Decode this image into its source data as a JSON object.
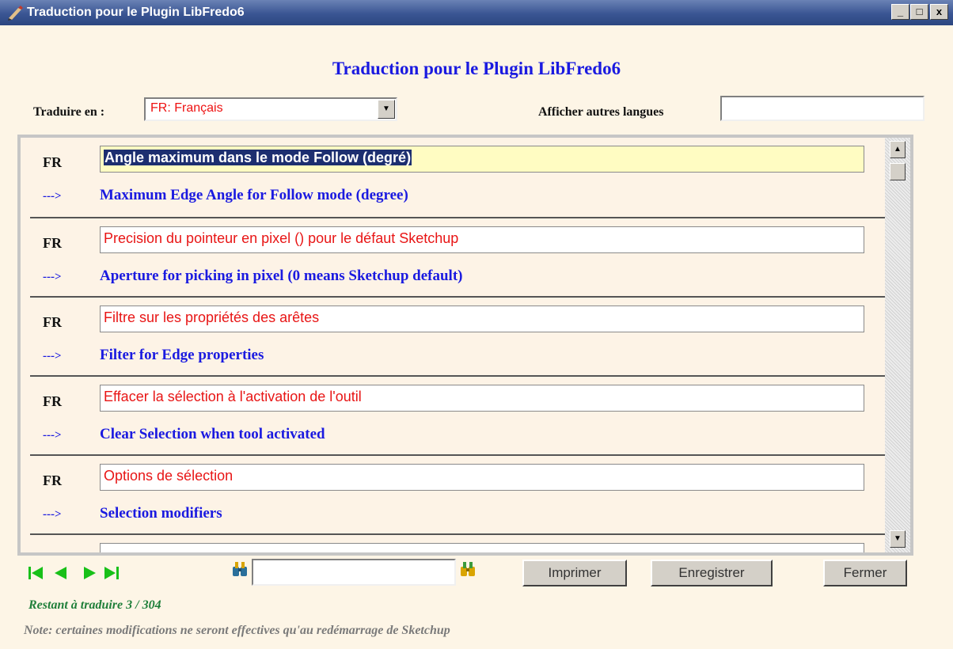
{
  "window": {
    "title": "Traduction pour le Plugin LibFredo6",
    "minimize": "_",
    "maximize": "□",
    "close": "x"
  },
  "heading": "Traduction pour le Plugin LibFredo6",
  "traduire_label": "Traduire en :",
  "language_select": {
    "value": "FR: Français"
  },
  "afficher_label": "Afficher autres langues",
  "afficher_value": "",
  "arrow_prefix": "--->",
  "entries": [
    {
      "code": "FR",
      "translation_text": "Angle maximum dans le mode Follow (degré)",
      "original": "Maximum Edge Angle for Follow mode (degree)"
    },
    {
      "code": "FR",
      "translation": "Precision du pointeur en pixel () pour le défaut Sketchup",
      "original": "Aperture for picking in pixel (0 means Sketchup default)"
    },
    {
      "code": "FR",
      "translation": "Filtre sur les propriétés des arêtes",
      "original": "Filter for Edge properties"
    },
    {
      "code": "FR",
      "translation": "Effacer la sélection à l'activation de l'outil",
      "original": "Clear Selection when tool activated"
    },
    {
      "code": "FR",
      "translation": "Options de sélection",
      "original": "Selection modifiers"
    },
    {
      "code": "",
      "translation": "",
      "original": ""
    }
  ],
  "navigation": {
    "icons": [
      "first-icon",
      "previous-icon",
      "next-icon",
      "last-icon"
    ],
    "nav_color": "#18c018"
  },
  "search": {
    "value": ""
  },
  "buttons": {
    "imprimer": "Imprimer",
    "enregistrer": "Enregistrer",
    "fermer": "Fermer"
  },
  "status": {
    "restant": "Restant à traduire 3 / 304",
    "note": "Note: certaines modifications ne seront effectives qu'au redémarrage de Sketchup"
  },
  "colors": {
    "title_bar": "#3a5593",
    "background": "#fdf5e6",
    "heading": "#1a1ae0",
    "translation_text": "#e81515",
    "status_green": "#1f7f3a"
  }
}
